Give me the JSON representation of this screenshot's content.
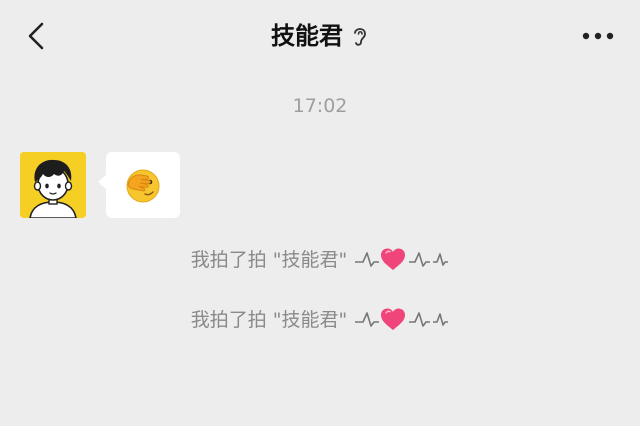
{
  "header": {
    "title": "技能君",
    "back_icon": "chevron-left-icon",
    "ear_icon": "ear-icon",
    "more_icon": "more-dots-icon"
  },
  "chat": {
    "timestamp": "17:02",
    "message": {
      "type": "emoji-sticker",
      "icon": "facepalm-emoji-icon"
    },
    "system_notices": [
      {
        "text": "我拍了拍 \"技能君\""
      },
      {
        "text": "我拍了拍 \"技能君\""
      }
    ]
  },
  "colors": {
    "background": "#ededed",
    "avatar_bg": "#f5cf23",
    "heart": "#f0457a",
    "notice_text": "#8a8a8a"
  }
}
